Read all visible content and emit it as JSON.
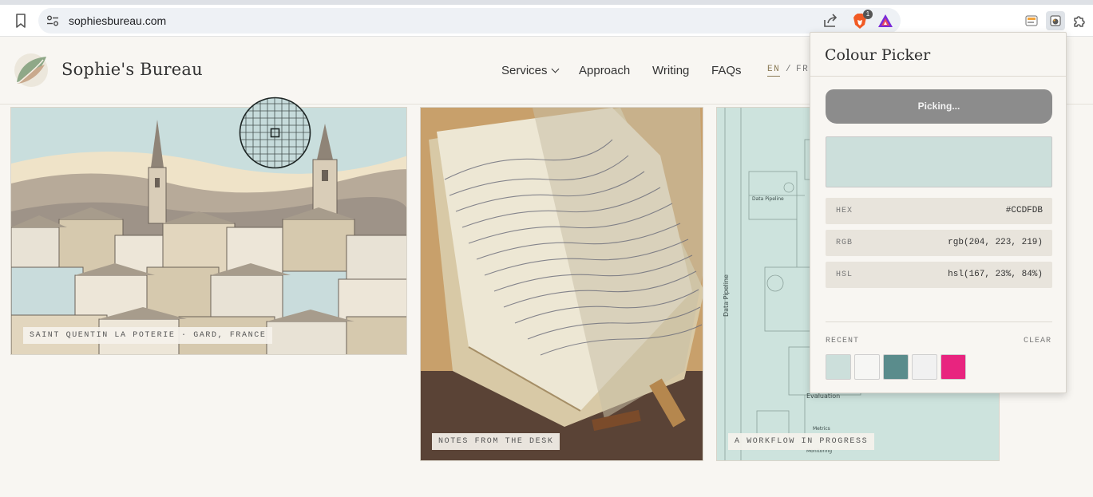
{
  "browser": {
    "url": "sophiesbureau.com",
    "brave_badge": "1"
  },
  "site": {
    "name": "Sophie's Bureau",
    "nav": {
      "services": "Services",
      "approach": "Approach",
      "writing": "Writing",
      "faqs": "FAQs"
    },
    "lang": {
      "en": "EN",
      "sep": "/",
      "fr": "FR"
    }
  },
  "gallery": [
    {
      "caption": "SAINT QUENTIN LA POTERIE · GARD, FRANCE"
    },
    {
      "caption": "NOTES FROM THE DESK"
    },
    {
      "caption": "A WORKFLOW IN PROGRESS"
    }
  ],
  "diagram_labels": {
    "data_pipeline_small": "Data Pipeline",
    "data_pipeline_vertical": "Data Pipeline",
    "evaluation": "Evaluation",
    "metrics": "Metrics",
    "monitoring": "Monitoring"
  },
  "picker": {
    "title": "Colour Picker",
    "button_label": "Picking...",
    "preview_color": "#CCDFDB",
    "hex_label": "HEX",
    "hex_value": "#CCDFDB",
    "rgb_label": "RGB",
    "rgb_value": "rgb(204, 223, 219)",
    "hsl_label": "HSL",
    "hsl_value": "hsl(167, 23%, 84%)",
    "recent_label": "RECENT",
    "clear_label": "CLEAR",
    "recent_colors": [
      "#CCDFDB",
      "#F6F6F4",
      "#5A8C8C",
      "#F1F1F1",
      "#E8247F"
    ]
  },
  "icons": {
    "bookmark": "bookmark-icon",
    "site_info": "site-info-icon",
    "share": "share-icon",
    "brave": "brave-lion-icon",
    "rewards": "brave-rewards-icon",
    "extension_1": "extension-icon",
    "extension_2": "colour-picker-extension-icon",
    "extensions_menu": "puzzle-icon"
  }
}
